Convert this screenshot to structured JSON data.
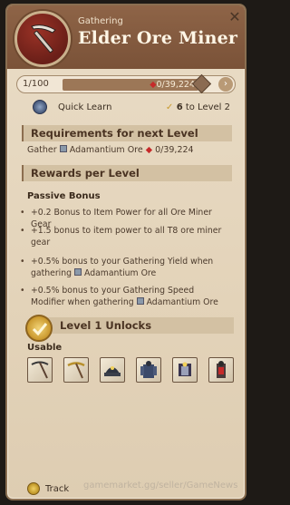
{
  "header": {
    "subtitle": "Gathering",
    "title": "Elder Ore Miner",
    "close_glyph": "✕",
    "emblem_icon": "pickaxe-icon"
  },
  "level": {
    "current": "1/100",
    "progress_text": "0/39,224",
    "progress_fraction": 0.0,
    "gem_icon": "fame-gem-icon"
  },
  "quick_learn": {
    "label": "Quick Learn",
    "right_count": "6",
    "right_suffix": " to Level 2"
  },
  "requirements": {
    "heading": "Requirements for next Level",
    "gather_label": "Gather",
    "resource": "Adamantium Ore",
    "amount": "0/39,224"
  },
  "rewards": {
    "heading": "Rewards per Level",
    "passive_label": "Passive Bonus",
    "bullets": [
      "+0.2 Bonus to Item Power for all Ore Miner Gear",
      "+1.5 bonus to item power to all T8 ore miner gear",
      "+0.5% bonus to your Gathering Yield when gathering",
      "+0.5% bonus to your Gathering Speed Modifier when gathering"
    ],
    "bullet_resource": "Adamantium Ore"
  },
  "unlocks": {
    "heading": "Level 1 Unlocks",
    "usable_label": "Usable",
    "items": [
      "pickaxe-item-1",
      "pickaxe-item-2",
      "miner-cap-item",
      "miner-garb-item",
      "miner-workboots-item",
      "miner-backpack-item"
    ]
  },
  "footer": {
    "track_label": "Track",
    "watermark": "gamemarket.gg/seller/GameNews"
  },
  "colors": {
    "header": "#7a5238",
    "panel": "#e3d3b9",
    "accent_red": "#c62a2a",
    "gold": "#c48f22"
  }
}
